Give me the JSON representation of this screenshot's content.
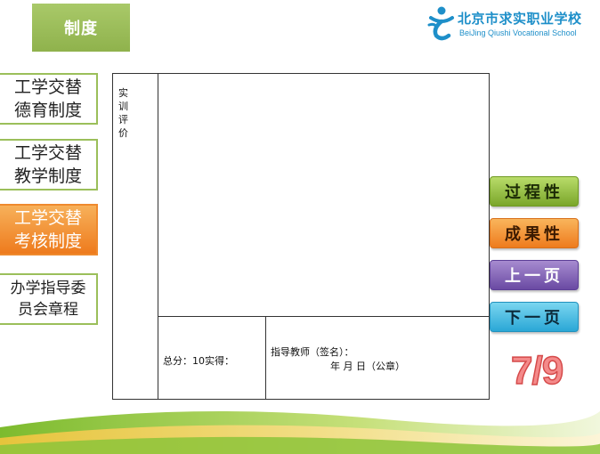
{
  "header": {
    "tab_label": "制度"
  },
  "logo": {
    "cn": "北京市求实职业学校",
    "en": "BeiJing Qiushi Vocational School",
    "color": "#1e8fc9"
  },
  "nav": {
    "items": [
      {
        "label": "工学交替\n德育制度",
        "active": false
      },
      {
        "label": "工学交替\n教学制度",
        "active": false
      },
      {
        "label": "工学交替\n考核制度",
        "active": true
      },
      {
        "label": "办学指导委\n员会章程",
        "active": false
      }
    ]
  },
  "form": {
    "section_label": "实训评价",
    "total_label": "总分：10实得：",
    "signature_label": "指导教师（签名）：",
    "date_label": "年  月  日（公章）"
  },
  "side_buttons": {
    "process": "过程性",
    "result": "成果性",
    "prev": "上一页",
    "next": "下一页"
  },
  "pager": {
    "current": "7/9"
  },
  "colors": {
    "green": "#8fb24c",
    "orange": "#ee7b1d",
    "purple": "#6a4aa3",
    "cyan": "#2aa7d6",
    "page_num": "#f48a8a"
  }
}
